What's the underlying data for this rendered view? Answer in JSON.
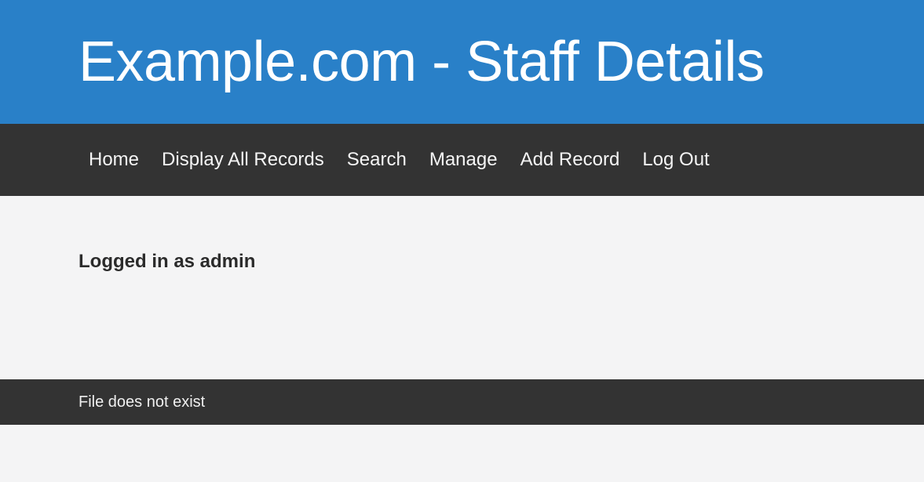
{
  "header": {
    "title": "Example.com - Staff Details",
    "background_color": "#2980c8",
    "text_color": "#ffffff"
  },
  "nav": {
    "background_color": "#333333",
    "items": [
      {
        "label": "Home",
        "name": "nav-link-home"
      },
      {
        "label": "Display All Records",
        "name": "nav-link-display-all-records"
      },
      {
        "label": "Search",
        "name": "nav-link-search"
      },
      {
        "label": "Manage",
        "name": "nav-link-manage"
      },
      {
        "label": "Add Record",
        "name": "nav-link-add-record"
      },
      {
        "label": "Log Out",
        "name": "nav-link-log-out"
      }
    ]
  },
  "main": {
    "login_status": "Logged in as admin",
    "background_color": "#f4f4f5"
  },
  "message_bar": {
    "text": "File does not exist",
    "background_color": "#333333",
    "text_color": "#efefef"
  }
}
